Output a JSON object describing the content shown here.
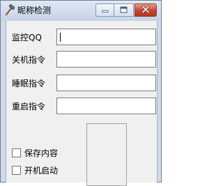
{
  "window": {
    "title": "昵称检测",
    "app_icon": "hammer-icon",
    "minimize_icon": "minimize-icon",
    "maximize_icon": "maximize-icon",
    "close_icon": "close-icon"
  },
  "form": {
    "fields": [
      {
        "label": "监控QQ",
        "value": ""
      },
      {
        "label": "关机指令",
        "value": ""
      },
      {
        "label": "睡眠指令",
        "value": ""
      },
      {
        "label": "重启指令",
        "value": ""
      }
    ],
    "checkboxes": [
      {
        "label": "保存内容",
        "checked": false
      },
      {
        "label": "开机启动",
        "checked": false
      }
    ]
  },
  "colors": {
    "title_bar": "#cfd9e8",
    "client_background": "#f0f0f0",
    "close_button": "#c4442f"
  }
}
